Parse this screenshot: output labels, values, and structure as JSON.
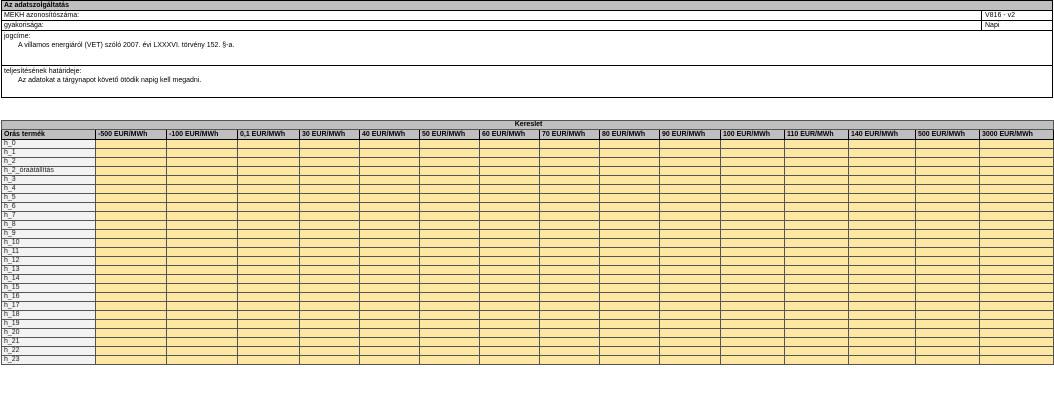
{
  "info": {
    "header": "Az adatszolgáltatás",
    "id_label": "MEKH azonosítószáma:",
    "id_value": "V816 - v2",
    "freq_label": "gyakorisága:",
    "freq_value": "Napi",
    "legal_label": "jogcíme:",
    "legal_text": "A villamos energiáról (VET) szóló 2007. évi LXXXVI. törvény 152. §-a.",
    "deadline_label": "teljesítésének határideje:",
    "deadline_text": "Az adatokat a tárgynapot követő ötödik napig kell megadni."
  },
  "grid": {
    "title": "Kereslet",
    "row_header": "Órás termék",
    "columns": [
      "-500 EUR/MWh",
      "-100 EUR/MWh",
      "0,1 EUR/MWh",
      "30 EUR/MWh",
      "40 EUR/MWh",
      "50 EUR/MWh",
      "60 EUR/MWh",
      "70 EUR/MWh",
      "80 EUR/MWh",
      "90 EUR/MWh",
      "100 EUR/MWh",
      "110 EUR/MWh",
      "140 EUR/MWh",
      "500 EUR/MWh",
      "3000 EUR/MWh"
    ],
    "rows": [
      "h_0",
      "h_1",
      "h_2",
      "h_2_óraátállítás",
      "h_3",
      "h_4",
      "h_5",
      "h_6",
      "h_7",
      "h_8",
      "h_9",
      "h_10",
      "h_11",
      "h_12",
      "h_13",
      "h_14",
      "h_15",
      "h_16",
      "h_17",
      "h_18",
      "h_19",
      "h_20",
      "h_21",
      "h_22",
      "h_23"
    ]
  }
}
